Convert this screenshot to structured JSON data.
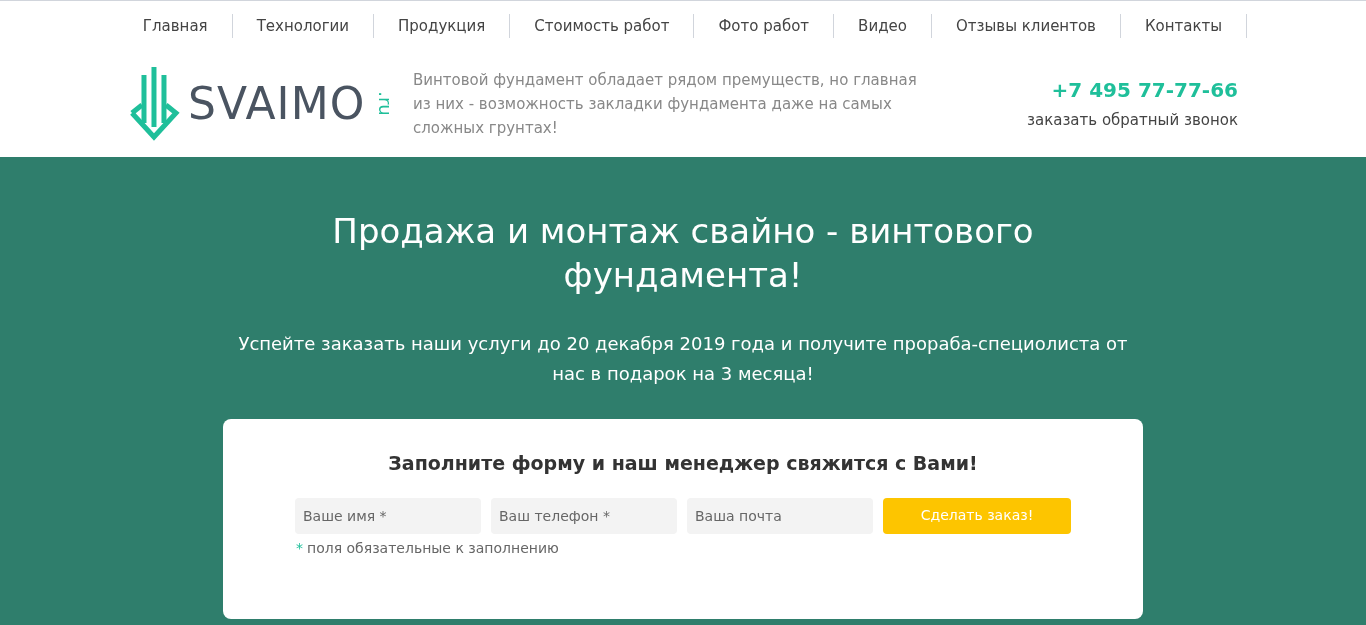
{
  "nav": [
    {
      "label": "Главная"
    },
    {
      "label": "Технологии"
    },
    {
      "label": "Продукция"
    },
    {
      "label": "Стоимость работ"
    },
    {
      "label": "Фото работ"
    },
    {
      "label": "Видео"
    },
    {
      "label": "Отзывы клиентов"
    },
    {
      "label": "Контакты"
    }
  ],
  "header": {
    "logo_text": "SVAIMO",
    "logo_suffix": ".ru",
    "tagline": "Винтовой фундамент обладает рядом премуществ, но главная из них - возможность закладки фундамента даже на самых сложных грунтах!",
    "phone": "+7 495 77-77-66",
    "callback_link": "заказать обратный звонок"
  },
  "hero": {
    "title": "Продажа и монтаж свайно - винтового фундамента!",
    "subtitle": "Успейте заказать наши услуги до 20 декабря 2019 года и получите прораба-специолиста от нас в подарок на 3 месяца!"
  },
  "form": {
    "title": "Заполните форму и наш менеджер свяжится с Вами!",
    "fields": [
      {
        "placeholder": "Ваше имя *"
      },
      {
        "placeholder": "Ваш телефон *"
      },
      {
        "placeholder": "Ваша почта"
      }
    ],
    "submit": "Сделать заказ!",
    "note_mark": "*",
    "note": "поля обязательные к заполнению"
  }
}
